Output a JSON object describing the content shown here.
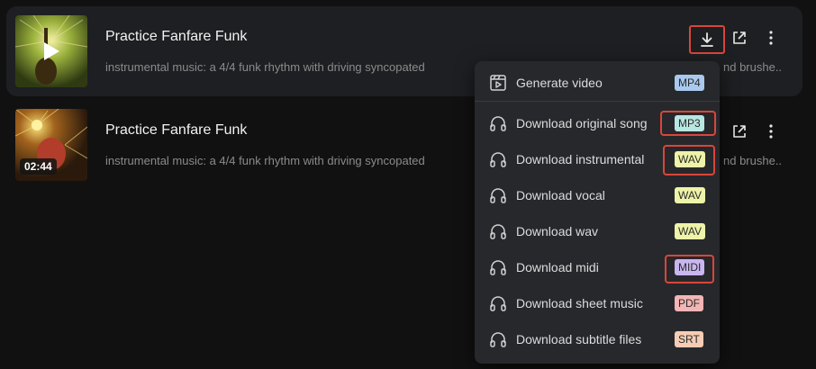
{
  "tracks": [
    {
      "title": "Practice Fanfare Funk",
      "description_left": "instrumental music: a 4/4 funk rhythm with driving syncopated",
      "description_right": "nd brushe...",
      "duration": ""
    },
    {
      "title": "Practice Fanfare Funk",
      "description_left": "instrumental music: a 4/4 funk rhythm with driving syncopated",
      "description_right": "nd brushe...",
      "duration": "02:44"
    }
  ],
  "menu": {
    "items": [
      {
        "label": "Generate video",
        "badge": "MP4",
        "badge_color": "#a9c9ee",
        "icon": "video-icon"
      },
      {
        "label": "Download original song",
        "badge": "MP3",
        "badge_color": "#b8e6e1",
        "icon": "headphones-icon"
      },
      {
        "label": "Download instrumental",
        "badge": "WAV",
        "badge_color": "#eef3a8",
        "icon": "headphones-icon"
      },
      {
        "label": "Download vocal",
        "badge": "WAV",
        "badge_color": "#eef3a8",
        "icon": "headphones-icon"
      },
      {
        "label": "Download wav",
        "badge": "WAV",
        "badge_color": "#eef3a8",
        "icon": "headphones-icon"
      },
      {
        "label": "Download midi",
        "badge": "MIDI",
        "badge_color": "#c9b6ef",
        "icon": "headphones-icon"
      },
      {
        "label": "Download sheet music",
        "badge": "PDF",
        "badge_color": "#f3b5b5",
        "icon": "headphones-icon"
      },
      {
        "label": "Download subtitle files",
        "badge": "SRT",
        "badge_color": "#f6cdb4",
        "icon": "headphones-icon"
      }
    ]
  },
  "colors": {
    "highlight": "#d9463a",
    "background": "#111111",
    "row_active": "#1e1f22",
    "menu_bg": "#27282c"
  }
}
